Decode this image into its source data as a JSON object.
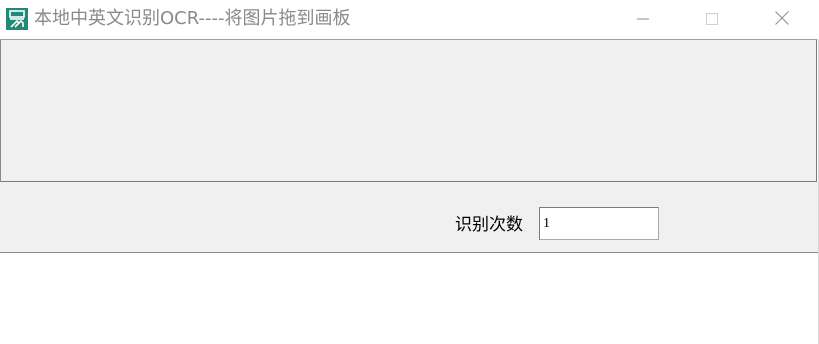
{
  "window": {
    "title": "本地中英文识别OCR----将图片拖到画板",
    "icon": "app-logo-icon",
    "controls": {
      "minimize_icon": "minimize-icon",
      "maximize_icon": "maximize-icon",
      "close_icon": "close-icon"
    }
  },
  "canvas": {
    "text": ""
  },
  "settings": {
    "count_label": "识别次数",
    "count_value": "1"
  },
  "result": {
    "text": ""
  },
  "colors": {
    "panel_bg": "#f0f0f0",
    "title_text": "#8a8a8a",
    "icon_bg": "#1f8a78"
  }
}
